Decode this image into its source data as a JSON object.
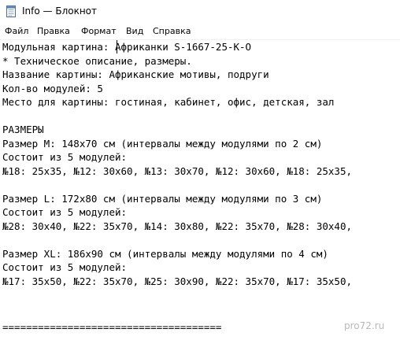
{
  "window": {
    "title": "Info — Блокнот",
    "icon": "notepad-icon"
  },
  "menu": {
    "file": "Файл",
    "edit": "Правка",
    "format": "Формат",
    "view": "Вид",
    "help": "Справка"
  },
  "document": {
    "lines": [
      "Модульная картина: Африканки S-1667-25-K-O",
      "* Техническое описание, размеры.",
      "Название картины: Африканские мотивы, подруги",
      "Кол-во модулей: 5",
      "Место для картины: гостиная, кабинет, офис, детская, зал",
      "",
      "РАЗМЕРЫ",
      "Размер М: 148x70 см (интервалы между модулями по 2 см)",
      "Состоит из 5 модулей:",
      "№18: 25x35, №12: 30x60, №13: 30x70, №12: 30x60, №18: 25x35,",
      "",
      "Размер L: 172x80 см (интервалы между модулями по 3 см)",
      "Состоит из 5 модулей:",
      "№28: 30x40, №22: 35x70, №14: 30x80, №22: 35x70, №28: 30x40,",
      "",
      "Размер XL: 186x90 см (интервалы между модулями по 4 см)",
      "Состоит из 5 модулей:",
      "№17: 35x50, №22: 35x70, №25: 30x90, №22: 35x70, №17: 35x50,",
      "",
      "",
      "",
      "====================================="
    ]
  },
  "watermark": "pro72.ru"
}
